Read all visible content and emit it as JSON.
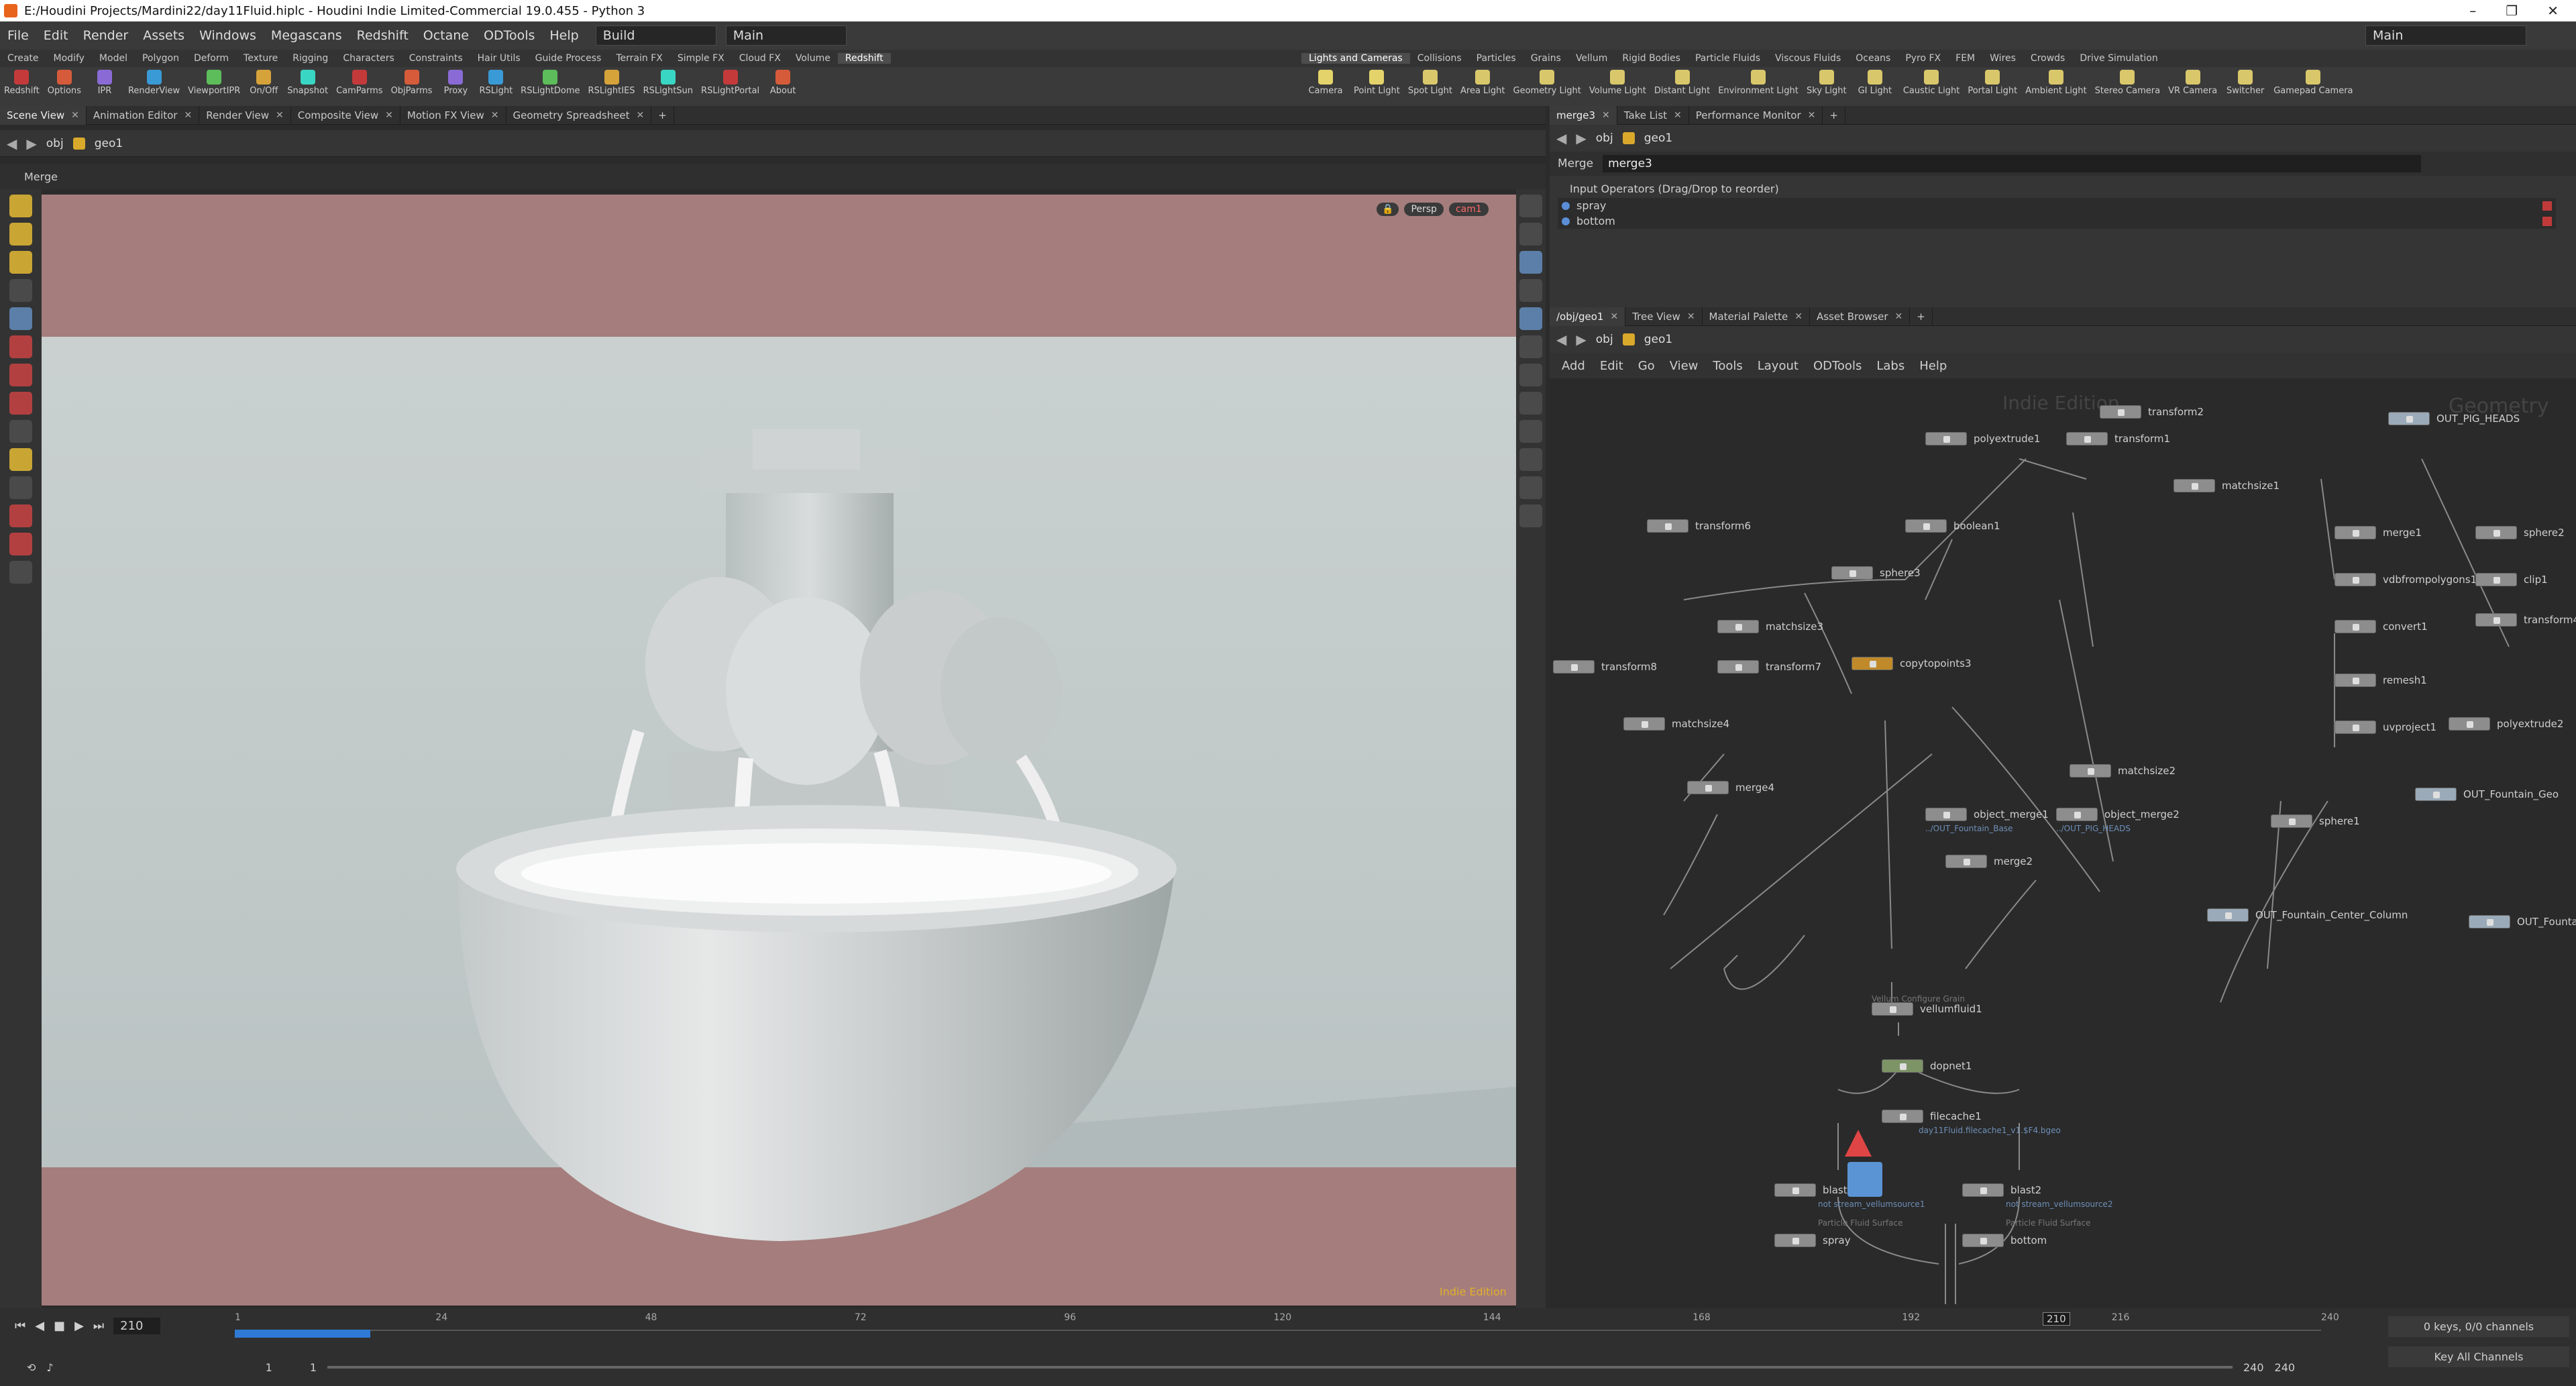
{
  "window": {
    "title": "E:/Houdini Projects/Mardini22/day11Fluid.hiplc - Houdini Indie Limited-Commercial 19.0.455 - Python 3"
  },
  "menu": {
    "items": [
      "File",
      "Edit",
      "Render",
      "Assets",
      "Windows",
      "Megascans",
      "Redshift",
      "Octane",
      "ODTools",
      "Help"
    ],
    "desktop": "Build",
    "network": "Main",
    "right_network": "Main"
  },
  "shelf_tabs_left": [
    "Create",
    "Modify",
    "Model",
    "Polygon",
    "Deform",
    "Texture",
    "Rigging",
    "Characters",
    "Constraints",
    "Hair Utils",
    "Guide Process",
    "Terrain FX",
    "Simple FX",
    "Cloud FX",
    "Volume",
    "Redshift"
  ],
  "shelf_tabs_right": [
    "Lights and Cameras",
    "Collisions",
    "Particles",
    "Grains",
    "Vellum",
    "Rigid Bodies",
    "Particle Fluids",
    "Viscous Fluids",
    "Oceans",
    "Pyro FX",
    "FEM",
    "Wires",
    "Crowds",
    "Drive Simulation"
  ],
  "shelf_tools_left": [
    "Redshift",
    "Options",
    "IPR",
    "RenderView",
    "ViewportIPR",
    "On/Off",
    "Snapshot",
    "CamParms",
    "ObjParms",
    "Proxy",
    "RSLight",
    "RSLightDome",
    "RSLightIES",
    "RSLightSun",
    "RSLightPortal",
    "About"
  ],
  "shelf_tools_right": [
    "Camera",
    "Point Light",
    "Spot Light",
    "Area Light",
    "Geometry Light",
    "Volume Light",
    "Distant Light",
    "Environment Light",
    "Sky Light",
    "GI Light",
    "Caustic Light",
    "Portal Light",
    "Ambient Light",
    "Stereo Camera",
    "VR Camera",
    "Switcher",
    "Gamepad Camera"
  ],
  "left_tabs": [
    "Scene View",
    "Animation Editor",
    "Render View",
    "Composite View",
    "Motion FX View",
    "Geometry Spreadsheet"
  ],
  "left_path": {
    "obj": "obj",
    "geo": "geo1"
  },
  "viewport": {
    "label": "Merge",
    "persp": "Persp",
    "cam": "cam1",
    "watermark": "Indie Edition"
  },
  "param_tabs": [
    "merge3",
    "Take List",
    "Performance Monitor"
  ],
  "param": {
    "obj": "obj",
    "geo": "geo1",
    "type": "Merge",
    "name": "merge3",
    "header": "Input Operators (Drag/Drop to reorder)",
    "inputs": [
      "spray",
      "bottom"
    ]
  },
  "net_tabs": [
    "/obj/geo1",
    "Tree View",
    "Material Palette",
    "Asset Browser"
  ],
  "net_path": {
    "obj": "obj",
    "geo": "geo1"
  },
  "net_menu": [
    "Add",
    "Edit",
    "Go",
    "View",
    "Tools",
    "Layout",
    "ODTools",
    "Labs",
    "Help"
  ],
  "net_watermark": {
    "edition": "Indie Edition",
    "context": "Geometry"
  },
  "nodes": [
    {
      "name": "transform2"
    },
    {
      "name": "polyextrude1"
    },
    {
      "name": "transform1"
    },
    {
      "name": "OUT_PIG_HEADS"
    },
    {
      "name": "matchsize1"
    },
    {
      "name": "transform6"
    },
    {
      "name": "boolean1"
    },
    {
      "name": "merge1"
    },
    {
      "name": "sphere2"
    },
    {
      "name": "sphere3"
    },
    {
      "name": "vdbfrompolygons1"
    },
    {
      "name": "clip1"
    },
    {
      "name": "matchsize3"
    },
    {
      "name": "convert1"
    },
    {
      "name": "transform4"
    },
    {
      "name": "transform8"
    },
    {
      "name": "transform7"
    },
    {
      "name": "copytopoints3"
    },
    {
      "name": "remesh1"
    },
    {
      "name": "polyextrude2"
    },
    {
      "name": "matchsize4"
    },
    {
      "name": "uvproject1"
    },
    {
      "name": "matchsize2"
    },
    {
      "name": "merge4"
    },
    {
      "name": "OUT_Fountain_Geo"
    },
    {
      "name": "object_merge1"
    },
    {
      "name": "object_merge2"
    },
    {
      "name": "sphere1"
    },
    {
      "name": "merge2"
    },
    {
      "name": "OUT_Fountain_Center_Column"
    },
    {
      "name": "OUT_Fountain_Ba"
    },
    {
      "name": "vellumfluid1"
    },
    {
      "name": "dopnet1"
    },
    {
      "name": "filecache1"
    },
    {
      "name": "blast3"
    },
    {
      "name": "blast2"
    },
    {
      "name": "spray"
    },
    {
      "name": "bottom"
    },
    {
      "name": "merge3"
    }
  ],
  "node_subs": {
    "om1": "../OUT_Fountain_Base",
    "om2": "../OUT_PIG_HEADS",
    "vf": "Vellum Configure Grain",
    "fc": "day11Fluid.filecache1_v1.$F4.bgeo",
    "b3": "not stream_vellumsource1",
    "b2": "not stream_vellumsource2",
    "pfs1": "Particle Fluid Surface",
    "pfs2": "Particle Fluid Surface"
  },
  "timeline": {
    "frame": "210",
    "ticks": [
      "1",
      "24",
      "48",
      "72",
      "96",
      "120",
      "144",
      "168",
      "192",
      "216",
      "240"
    ],
    "start": "1",
    "start2": "1",
    "end": "240",
    "end2": "240",
    "current_marker": "210",
    "keys": "0 keys, 0/0 channels",
    "key_all": "Key All Channels",
    "progress": 0.13
  }
}
